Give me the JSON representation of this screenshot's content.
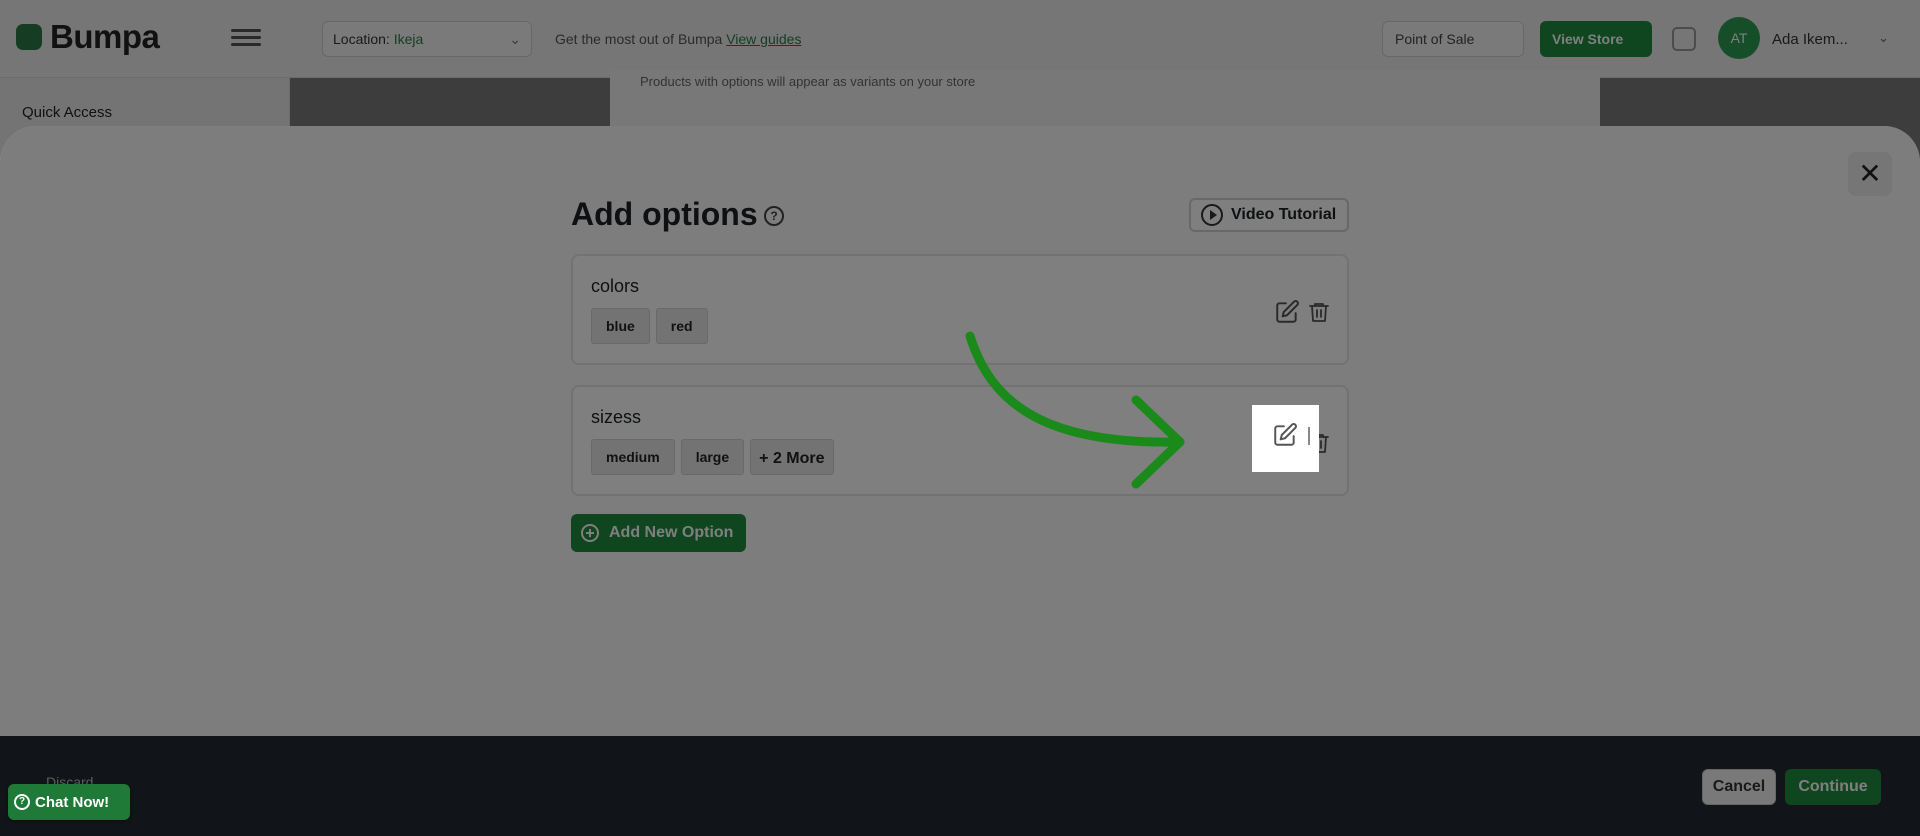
{
  "app": {
    "brand": "Bumpa",
    "location_label": "Location:",
    "location_value": "Ikeja",
    "top_hint_text": "Get the most out of Bumpa",
    "top_hint_link": "View guides",
    "point_of_sale_label": "Point of Sale",
    "view_store_label": "View Store",
    "user_initials": "AT",
    "user_name": "Ada Ikem...",
    "sidebar_title": "Quick Access",
    "bg_note": "Products with options will appear as variants on your store"
  },
  "modal": {
    "title": "Add options",
    "help_glyph": "?",
    "video_tutorial_label": "Video Tutorial",
    "close_glyph": "✕",
    "options": [
      {
        "name": "colors",
        "values": [
          "blue",
          "red"
        ],
        "more": ""
      },
      {
        "name": "sizess",
        "values": [
          "medium",
          "large"
        ],
        "more": "+ 2 More"
      }
    ],
    "add_option_label": "Add New Option"
  },
  "footer": {
    "left_text": "Discard",
    "cancel_label": "Cancel",
    "continue_label": "Continue"
  },
  "chat": {
    "label": "Chat Now!",
    "icon_glyph": "?"
  },
  "colors": {
    "brand_green": "#1f8a3e",
    "arrow_green": "#1a8a1a",
    "footer_bg": "#232b33"
  }
}
